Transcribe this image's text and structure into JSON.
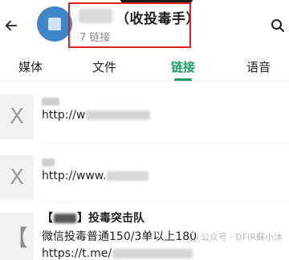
{
  "header": {
    "title": "（收投毒手）",
    "subtitle": "7 链接",
    "back_icon": "back-arrow-icon",
    "search_icon": "search-icon"
  },
  "tabs": [
    {
      "label": "媒体",
      "active": false
    },
    {
      "label": "文件",
      "active": false
    },
    {
      "label": "链接",
      "active": true
    },
    {
      "label": "语音",
      "active": false
    }
  ],
  "links": [
    {
      "thumb": "X",
      "url_prefix": "http://w"
    },
    {
      "thumb": "X",
      "url_prefix": "http://www."
    },
    {
      "thumb": "【",
      "title_open": "【",
      "title_close": "】投毒突击队",
      "description": "微信投毒普通150/3单以上180",
      "url_prefix": "https://t.me/"
    }
  ],
  "watermark": "公众号 · DFIR蘇小沐",
  "colors": {
    "accent": "#1e9e62",
    "highlight_box": "#e0201c",
    "avatar": "#3f86c7"
  }
}
